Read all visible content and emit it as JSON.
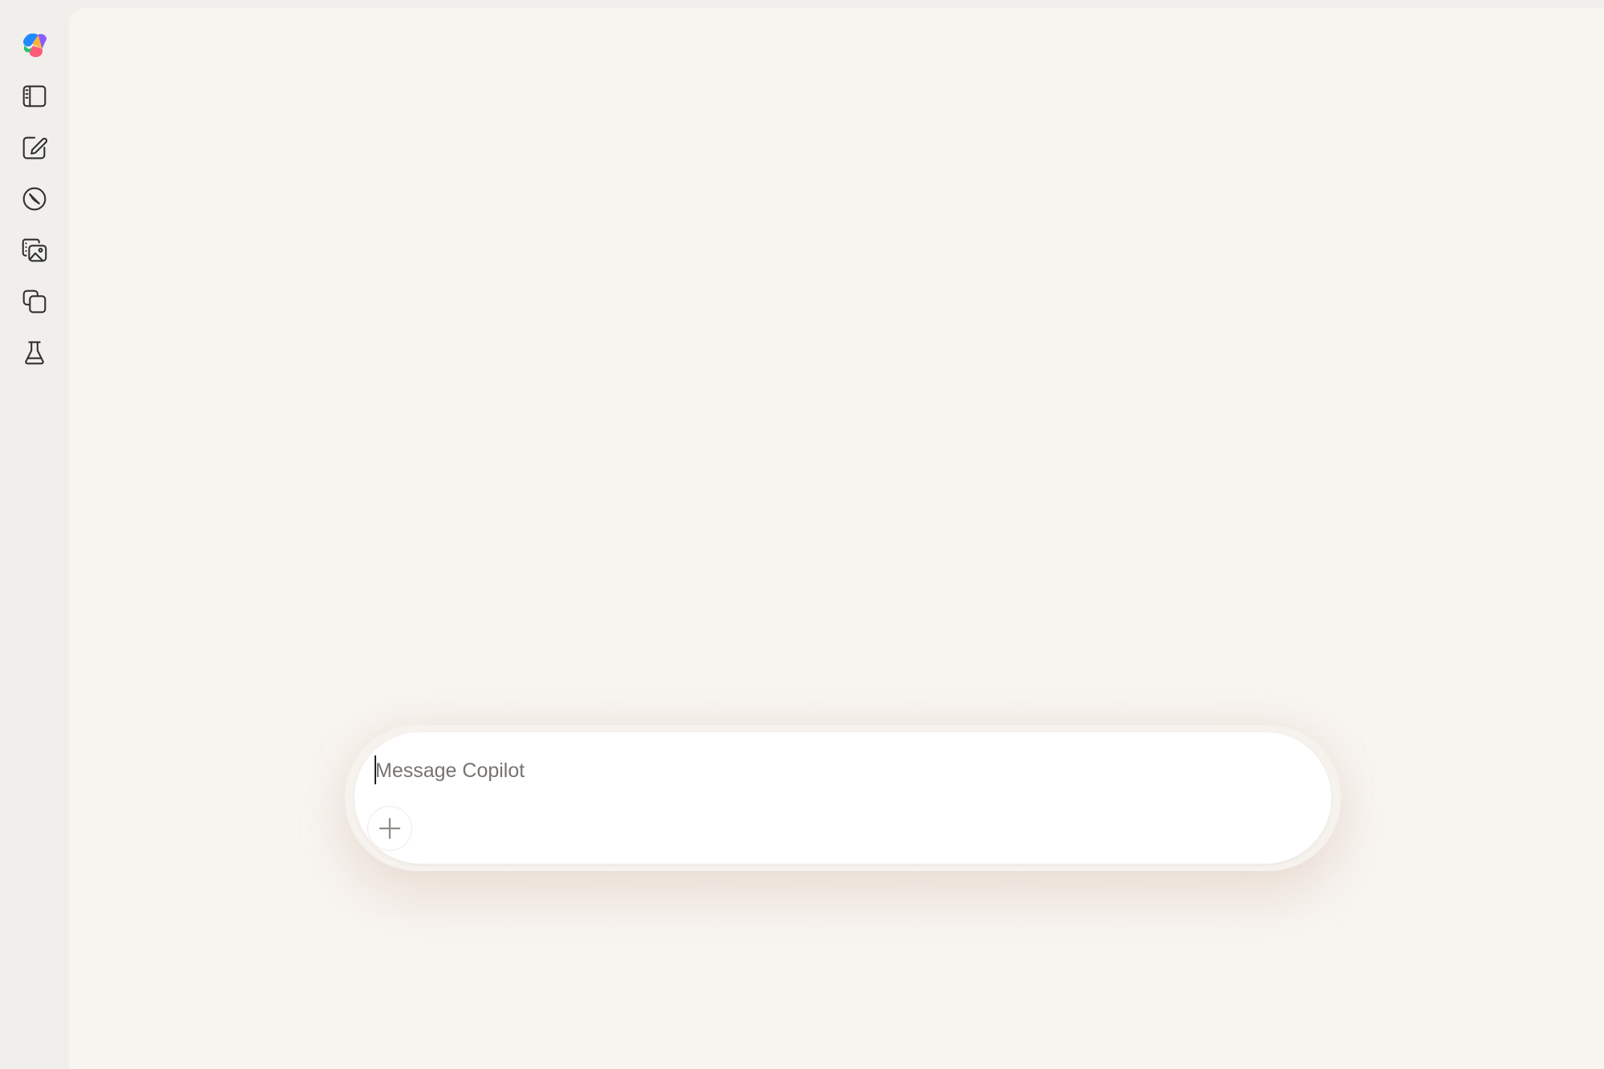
{
  "sidebar": {
    "items": [
      {
        "name": "copilot-logo",
        "icon": "copilot-logo-icon"
      },
      {
        "name": "toggle-sidebar",
        "icon": "sidebar-panel-icon"
      },
      {
        "name": "new-chat",
        "icon": "compose-icon"
      },
      {
        "name": "discover",
        "icon": "compass-icon"
      },
      {
        "name": "imagine",
        "icon": "image-gallery-icon"
      },
      {
        "name": "pages",
        "icon": "pages-icon"
      },
      {
        "name": "labs",
        "icon": "flask-icon"
      }
    ]
  },
  "composer": {
    "placeholder": "Message Copilot",
    "value": "",
    "add_icon": "plus-icon"
  },
  "colors": {
    "rail_background": "#f1efec",
    "main_background": "#f8f5f1",
    "composer_background": "#ffffff",
    "icon_stroke": "#303030",
    "placeholder_text": "#77736e"
  }
}
